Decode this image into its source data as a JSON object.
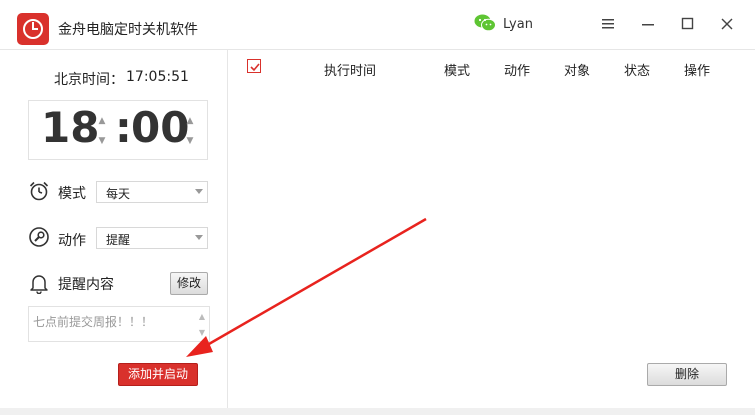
{
  "window": {
    "title": "金舟电脑定时关机软件",
    "user_name": "Lyan",
    "accent_color": "#d9312c"
  },
  "left": {
    "beijing_label": "北京时间：",
    "beijing_time": "17:05:51",
    "hour": "18",
    "colon": ":",
    "minute": "00",
    "mode_label": "模式",
    "mode_value": "每天",
    "action_label": "动作",
    "action_value": "提醒",
    "content_label": "提醒内容",
    "modify_label": "修改",
    "content_text": "七点前提交周报！！！",
    "add_start_label": "添加并启动"
  },
  "table": {
    "headers": [
      "执行时间",
      "模式",
      "动作",
      "对象",
      "状态",
      "操作"
    ],
    "header_checked": true,
    "rows": []
  },
  "right": {
    "delete_label": "删除"
  },
  "icons": {
    "logo": "alarm-clock-icon",
    "wechat": "wechat-icon",
    "mode": "alarm-clock-icon",
    "action": "wrench-icon",
    "content": "bell-icon"
  },
  "annotation_color": "#e8231e"
}
